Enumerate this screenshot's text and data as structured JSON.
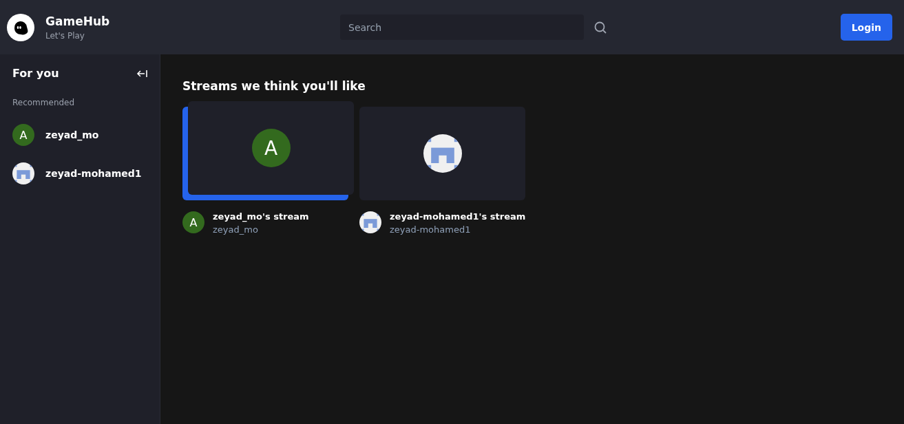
{
  "brand": {
    "title": "GameHub",
    "subtitle": "Let's Play"
  },
  "search": {
    "placeholder": "Search"
  },
  "login_button": "Login",
  "sidebar": {
    "title": "For you",
    "section": "Recommended",
    "items": [
      {
        "name": "zeyad_mo",
        "avatar": {
          "kind": "letter",
          "letter": "A",
          "color": "#336a1e"
        }
      },
      {
        "name": "zeyad-mohamed1",
        "avatar": {
          "kind": "identicon"
        }
      }
    ]
  },
  "heading": "Streams we think you'll like",
  "streams": [
    {
      "title": "zeyad_mo's stream",
      "user": "zeyad_mo",
      "hovered": true,
      "thumbnail_avatar": {
        "kind": "letter",
        "letter": "A",
        "color": "#336a1e"
      },
      "avatar": {
        "kind": "letter",
        "letter": "A",
        "color": "#336a1e"
      }
    },
    {
      "title": "zeyad-mohamed1's stream",
      "user": "zeyad-mohamed1",
      "hovered": false,
      "thumbnail_avatar": {
        "kind": "identicon"
      },
      "avatar": {
        "kind": "identicon"
      }
    }
  ]
}
